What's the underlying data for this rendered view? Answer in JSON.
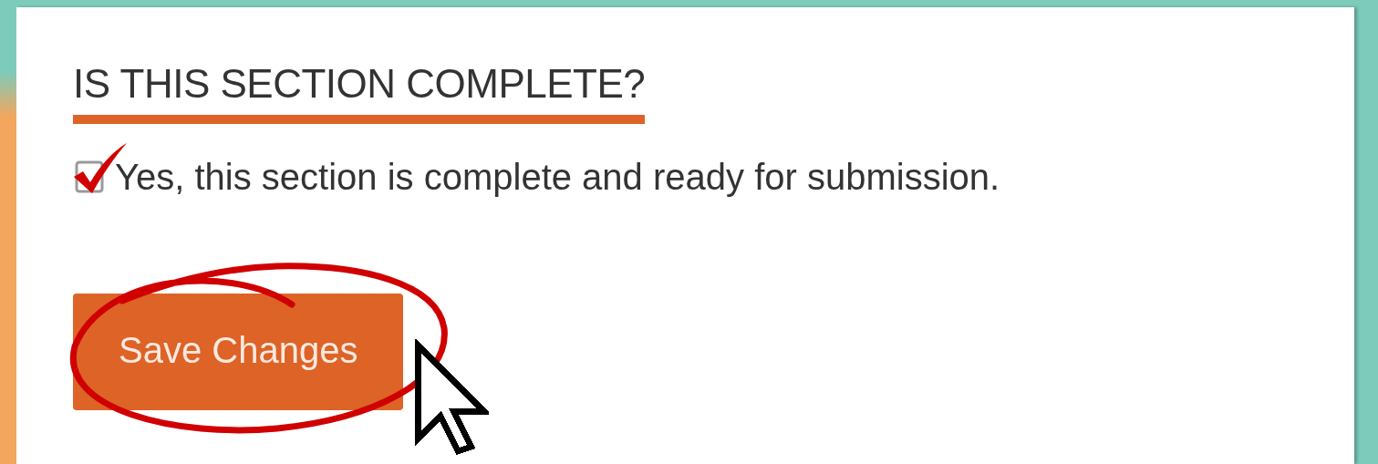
{
  "section_heading": "IS THIS SECTION COMPLETE?",
  "completion_checkbox": {
    "label": "Yes, this section is complete and ready for submission.",
    "checked": true
  },
  "save_button": {
    "label": "Save Changes"
  }
}
